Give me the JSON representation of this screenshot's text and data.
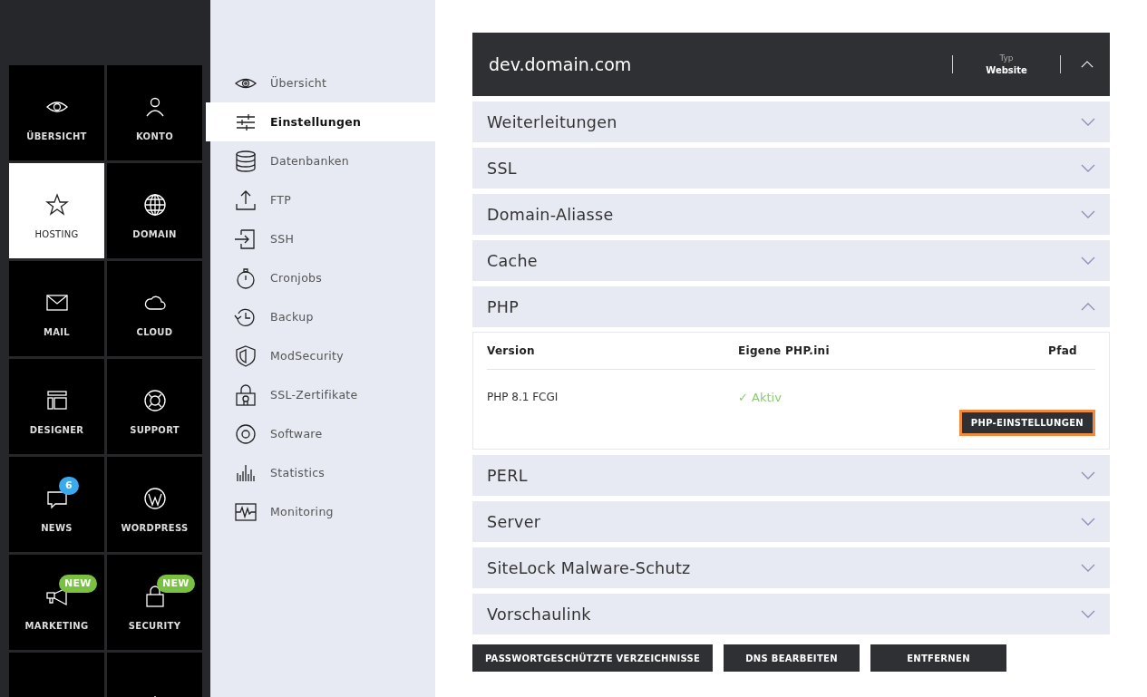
{
  "tiles": [
    {
      "label": "ÜBERSICHT",
      "selected": false
    },
    {
      "label": "KONTO",
      "selected": false
    },
    {
      "label": "HOSTING",
      "selected": true
    },
    {
      "label": "DOMAIN",
      "selected": false
    },
    {
      "label": "MAIL",
      "selected": false
    },
    {
      "label": "CLOUD",
      "selected": false
    },
    {
      "label": "DESIGNER",
      "selected": false
    },
    {
      "label": "SUPPORT",
      "selected": false
    },
    {
      "label": "NEWS",
      "selected": false,
      "badge": {
        "kind": "count",
        "text": "6"
      }
    },
    {
      "label": "WORDPRESS",
      "selected": false
    },
    {
      "label": "MARKETING",
      "selected": false,
      "badge": {
        "kind": "new",
        "text": "NEW"
      }
    },
    {
      "label": "SECURITY",
      "selected": false,
      "badge": {
        "kind": "new",
        "text": "NEW"
      }
    },
    {
      "selected": false
    },
    {
      "selected": false
    }
  ],
  "submenu": [
    {
      "label": "Übersicht",
      "selected": false
    },
    {
      "label": "Einstellungen",
      "selected": true
    },
    {
      "label": "Datenbanken",
      "selected": false
    },
    {
      "label": "FTP",
      "selected": false
    },
    {
      "label": "SSH",
      "selected": false
    },
    {
      "label": "Cronjobs",
      "selected": false
    },
    {
      "label": "Backup",
      "selected": false
    },
    {
      "label": "ModSecurity",
      "selected": false
    },
    {
      "label": "SSL-Zertifikate",
      "selected": false
    },
    {
      "label": "Software",
      "selected": false
    },
    {
      "label": "Statistics",
      "selected": false
    },
    {
      "label": "Monitoring",
      "selected": false
    }
  ],
  "header": {
    "title": "dev.domain.com",
    "type_label": "Typ",
    "type_value": "Website",
    "expanded": true
  },
  "sections": [
    {
      "title": "Weiterleitungen",
      "expanded": false
    },
    {
      "title": "SSL",
      "expanded": false
    },
    {
      "title": "Domain-Aliasse",
      "expanded": false
    },
    {
      "title": "Cache",
      "expanded": false
    },
    {
      "title": "PHP",
      "expanded": true,
      "details": {
        "columns": [
          "Version",
          "Eigene PHP.ini",
          "Pfad"
        ],
        "row": [
          "PHP 8.1 FCGI",
          "✓ Aktiv"
        ],
        "button": "PHP-EINSTELLUNGEN"
      }
    },
    {
      "title": "PERL",
      "expanded": false
    },
    {
      "title": "Server",
      "expanded": false
    },
    {
      "title": "SiteLock Malware-Schutz",
      "expanded": false
    },
    {
      "title": "Vorschaulink",
      "expanded": false
    }
  ],
  "actions": [
    "PASSWORTGESCHÜTZTE VERZEICHNISSE",
    "DNS BEARBEITEN",
    "ENTFERNEN"
  ]
}
